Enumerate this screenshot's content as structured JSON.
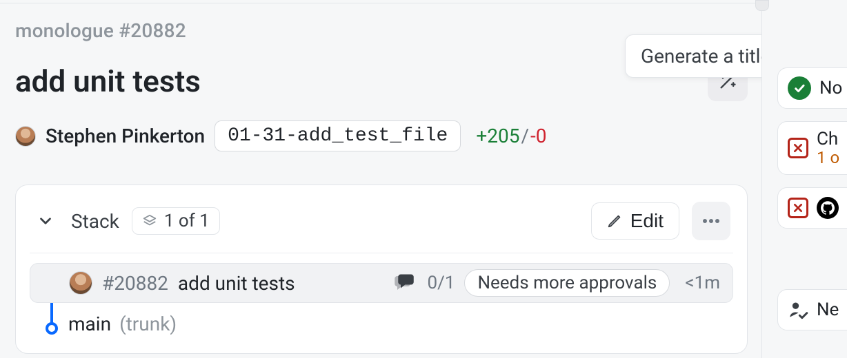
{
  "breadcrumb": {
    "repo": "monologue",
    "number": "#20882"
  },
  "title": "add unit tests",
  "ai_tooltip": "Generate a title with AI",
  "author": "Stephen Pinkerton",
  "branch": "01-31-add_test_file",
  "diff": {
    "plus": "+205",
    "slash": "/",
    "minus": "-0"
  },
  "stack": {
    "label": "Stack",
    "count": "1 of 1",
    "edit": "Edit",
    "current": {
      "number": "#20882",
      "title": "add unit tests",
      "reviews": "0/1",
      "needs": "Needs more approvals",
      "age": "<1m"
    },
    "base": {
      "name": "main",
      "suffix": "(trunk)"
    }
  },
  "sidebar": {
    "item1": "No",
    "item2a": "Ch",
    "item2b": "1 o",
    "item4": "Ne"
  }
}
